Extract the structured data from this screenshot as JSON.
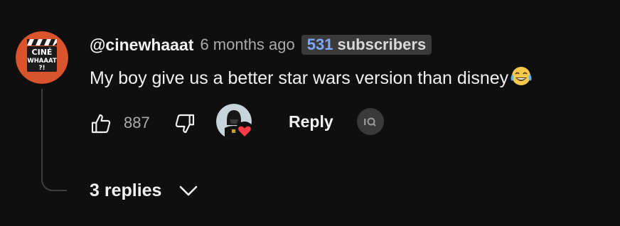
{
  "comment": {
    "author": "@cinewhaaat",
    "timestamp": "6 months ago",
    "subscriber_badge": {
      "count": "531",
      "label": "subscribers",
      "count_color": "#7fa7ff"
    },
    "text": "My boy give us a better star wars version than disney",
    "emoji": "😂",
    "avatar": {
      "icon": "clapperboard-logo",
      "lines": [
        "CINÉ",
        "WHAAAT",
        "?!"
      ],
      "background": "#d9532c"
    },
    "actions": {
      "like_icon": "thumbs-up-icon",
      "like_count": "887",
      "dislike_icon": "thumbs-down-icon",
      "hearted_by_creator": true,
      "heart_color": "#ff3b4a",
      "reply_label": "Reply",
      "extension_icon": "extension-icon"
    },
    "replies": {
      "label": "3 replies",
      "icon": "chevron-down-icon"
    }
  }
}
